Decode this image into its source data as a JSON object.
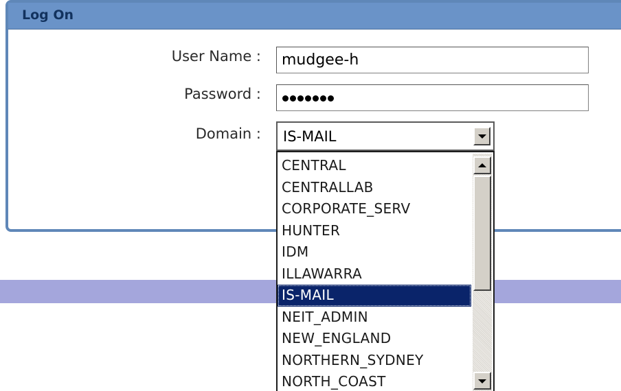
{
  "panel": {
    "title": "Log On"
  },
  "form": {
    "username_label": "User Name :",
    "username_value": "mudgee-h",
    "password_label": "Password :",
    "password_length": 7,
    "domain_label": "Domain :",
    "domain_value": "IS-MAIL"
  },
  "dropdown": {
    "options": [
      "CENTRAL",
      "CENTRALLAB",
      "CORPORATE_SERV",
      "HUNTER",
      "IDM",
      "ILLAWARRA",
      "IS-MAIL",
      "NEIT_ADMIN",
      "NEW_ENGLAND",
      "NORTHERN_SYDNEY",
      "NORTH_COAST"
    ],
    "selected_index": 6
  },
  "colors": {
    "panel_border": "#5f87b8",
    "header_bg": "#6a93c8",
    "title_text": "#12325e",
    "band": "#a4a6dc",
    "selected_bg": "#0a246a"
  },
  "icons": {
    "select_arrow": "chevron-down-icon",
    "scroll_up": "scroll-up-arrow-icon",
    "scroll_down": "scroll-down-arrow-icon"
  }
}
